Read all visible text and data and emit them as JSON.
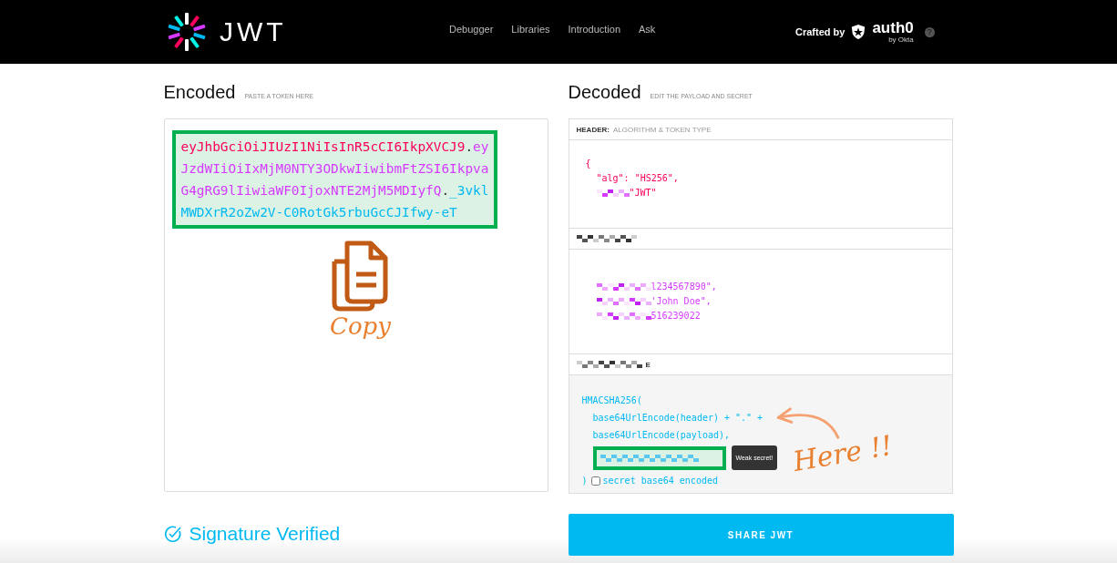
{
  "nav": {
    "logo_text": "JWT",
    "links": [
      {
        "label": "Debugger"
      },
      {
        "label": "Libraries"
      },
      {
        "label": "Introduction"
      },
      {
        "label": "Ask"
      }
    ],
    "crafted_by": "Crafted by",
    "brand": "auth0",
    "brand_sub": "by Okta",
    "help": "?"
  },
  "encoded": {
    "title": "Encoded",
    "hint": "PASTE A TOKEN HERE",
    "highlighted": true,
    "token_lines": [
      [
        {
          "color": "#fb015b",
          "text": "eyJhbGciOiJIUzI1NiIsInR5cCI6IkpXVCJ9"
        },
        {
          "text": "."
        },
        {
          "color": "#d63aff",
          "text": "ey"
        }
      ],
      [
        {
          "color": "#d63aff",
          "text": "JzdWIiOiIxMjM0NTY3ODkwIiwibmFtZSI6Ikpva"
        }
      ],
      [
        {
          "color": "#d63aff",
          "text": "G4gRG9lIiwiaWF0IjoxNTE2MjM5MDIyfQ"
        },
        {
          "text": "."
        },
        {
          "color": "#00b9f1",
          "text": "_3vkl"
        }
      ],
      [
        {
          "color": "#00b9f1",
          "text": "MWDXrR2oZw2V-C0RotGk5rbuGcCJIfwy-eT"
        }
      ]
    ]
  },
  "copy_annotation": {
    "label": "Copy"
  },
  "decoded": {
    "title": "Decoded",
    "hint": "EDIT THE PAYLOAD AND SECRET",
    "header_section": {
      "label": "HEADER:",
      "sublabel": "ALGORITHM & TOKEN TYPE",
      "lines": [
        {
          "text": "{",
          "masked": false
        },
        {
          "text": "\"alg\": \"HS256\",",
          "masked": false
        },
        {
          "text": "\"JWT\"",
          "masked": true
        }
      ]
    },
    "payload_section": {
      "lines": [
        {
          "text": "l234567890\",",
          "masked": true
        },
        {
          "text": "'John Doe\",",
          "masked": true
        },
        {
          "text": "516239022",
          "masked": true
        }
      ]
    },
    "signature_section": {
      "label_tail": "E",
      "lines": [
        "HMACSHA256(",
        "base64UrlEncode(header) + \".\" +",
        "base64UrlEncode(payload),"
      ],
      "secret_highlighted": true,
      "tooltip": "Weak secret!",
      "close": ")",
      "base64_checkbox": {
        "label": "secret base64 encoded",
        "checked": false
      }
    }
  },
  "here_annotation": {
    "label": "Here !!"
  },
  "status": {
    "label": "Signature Verified"
  },
  "share_button": {
    "label": "SHARE JWT"
  }
}
